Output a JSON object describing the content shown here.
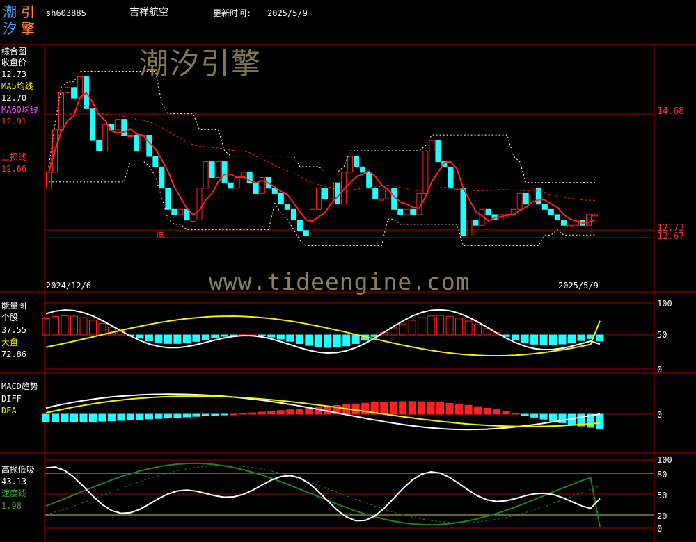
{
  "header": {
    "logo_chars": [
      "潮",
      "引",
      "汐",
      "擎"
    ],
    "code": "sh603885",
    "name": "吉祥航空",
    "update_label": "更新时间:",
    "update_date": "2025/5/9"
  },
  "watermark": "潮汐引擎",
  "url_watermark": "www.tideengine.com",
  "panels": {
    "main": {
      "title": "综合图",
      "close_label": "收盘价",
      "close_value": "12.73",
      "ma5_label": "MA5均线",
      "ma5_value": "12.70",
      "ma60_label": "MA60均线",
      "ma60_value": "12.91",
      "stop_label": "止损线",
      "stop_value": "12.66",
      "start_date": "2024/12/6",
      "end_date": "2025/5/9",
      "bottom_marker": "底",
      "right_labels": [
        "14.68",
        "12.73",
        "12.67"
      ]
    },
    "energy": {
      "title": "能量图",
      "stock_label": "个股",
      "stock_value": "37.55",
      "market_label": "大盘",
      "market_value": "72.86",
      "axis": [
        "100",
        "50",
        "0"
      ]
    },
    "macd": {
      "title": "MACD趋势",
      "diff_label": "DIFF",
      "dea_label": "DEA",
      "axis": [
        "0"
      ]
    },
    "hilo": {
      "title": "高抛低吸",
      "value": "43.13",
      "speed_label": "速度线",
      "speed_value": "1.98",
      "axis": [
        "100",
        "80",
        "50",
        "20",
        "0"
      ]
    }
  },
  "colors": {
    "up": "#ff2020",
    "down": "#20ffff",
    "ma": "#ff2020",
    "yellow": "#f0f000",
    "green": "#208020",
    "grid": "#a00000",
    "watermark": "#8a7f52"
  },
  "chart_data": [
    {
      "type": "candlestick",
      "title": "综合图",
      "xlabel": "",
      "ylabel": "",
      "x_start": "2024/12/6",
      "x_end": "2025/5/9",
      "ylim": [
        12.0,
        15.8
      ],
      "closes": [
        13.6,
        14.4,
        15.1,
        15.2,
        15.0,
        15.4,
        14.8,
        14.2,
        14.0,
        14.5,
        14.4,
        14.6,
        14.3,
        14.3,
        14.0,
        14.3,
        13.9,
        13.7,
        13.3,
        12.9,
        12.8,
        12.9,
        12.7,
        12.7,
        13.3,
        13.8,
        13.5,
        13.8,
        13.4,
        13.3,
        13.5,
        13.6,
        13.4,
        13.2,
        13.5,
        13.3,
        13.2,
        13.0,
        12.9,
        12.7,
        12.5,
        12.4,
        12.9,
        13.3,
        13.1,
        13.4,
        13.0,
        13.6,
        13.9,
        13.7,
        13.6,
        13.3,
        13.1,
        13.1,
        13.3,
        12.9,
        12.8,
        12.9,
        12.8,
        13.2,
        14.0,
        14.2,
        13.8,
        13.7,
        13.3,
        13.3,
        12.4,
        12.7,
        12.6,
        12.9,
        12.8,
        12.7,
        12.8,
        12.8,
        12.9,
        13.2,
        13.0,
        13.3,
        13.0,
        12.9,
        12.8,
        12.7,
        12.6,
        12.6,
        12.7,
        12.6,
        12.8,
        12.8
      ],
      "stop_line": 12.66,
      "upper_band_max": 15.15,
      "lower_band_min": 12.07
    },
    {
      "type": "line",
      "title": "能量图",
      "ylim": [
        0,
        100
      ],
      "series": [
        {
          "name": "个股",
          "last": 37.55
        },
        {
          "name": "大盘",
          "last": 72.86
        }
      ]
    },
    {
      "type": "line",
      "title": "MACD趋势",
      "series": [
        {
          "name": "DIFF"
        },
        {
          "name": "DEA"
        }
      ]
    },
    {
      "type": "line",
      "title": "高抛低吸",
      "ylim": [
        0,
        100
      ],
      "yticks": [
        0,
        20,
        50,
        80,
        100
      ],
      "series": [
        {
          "name": "高抛低吸",
          "last": 43.13
        },
        {
          "name": "速度线",
          "last": 1.98
        }
      ]
    }
  ]
}
